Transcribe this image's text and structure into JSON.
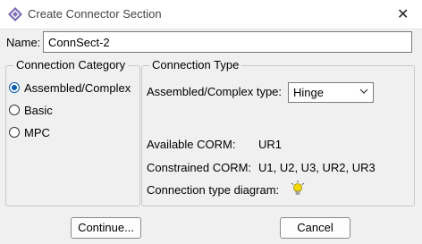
{
  "window": {
    "title": "Create Connector Section",
    "close_glyph": "✕"
  },
  "name": {
    "label": "Name:",
    "value": "ConnSect-2"
  },
  "connection_category": {
    "legend": "Connection Category",
    "options": [
      {
        "label": "Assembled/Complex",
        "checked": true
      },
      {
        "label": "Basic",
        "checked": false
      },
      {
        "label": "MPC",
        "checked": false
      }
    ]
  },
  "connection_type": {
    "legend": "Connection Type",
    "type_label": "Assembled/Complex type:",
    "type_value": "Hinge",
    "available_corm_label": "Available CORM:",
    "available_corm_value": "UR1",
    "constrained_corm_label": "Constrained CORM:",
    "constrained_corm_value": "U1, U2, U3, UR2, UR3",
    "diagram_label": "Connection type diagram:",
    "diagram_icon": "lightbulb-icon"
  },
  "buttons": {
    "continue": "Continue...",
    "cancel": "Cancel"
  },
  "colors": {
    "radio_accent": "#0b5cad",
    "app_icon": "#7b6bb5",
    "bulb": "#f5d800"
  }
}
